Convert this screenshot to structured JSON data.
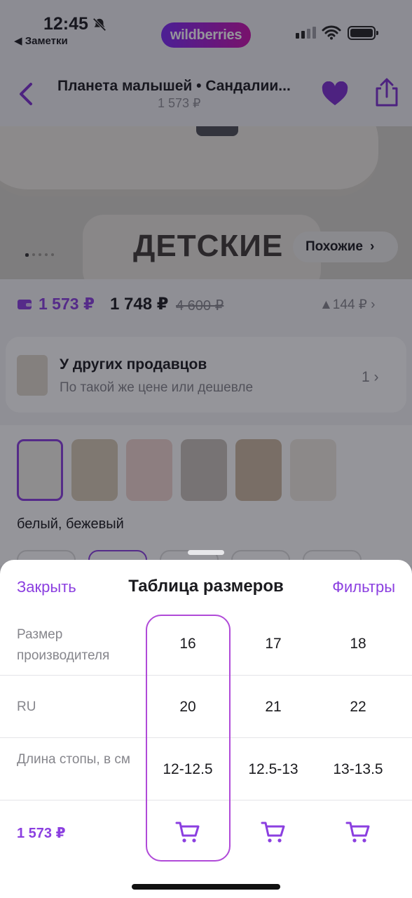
{
  "status_bar": {
    "time": "12:45",
    "back_app": "◀ Заметки",
    "brand": "wildberries"
  },
  "header": {
    "title": "Планета малышей • Сандалии...",
    "price": "1 573 ₽"
  },
  "hero": {
    "banner_text": "ДЕТСКИЕ",
    "similar_label": "Похожие",
    "similar_chevron": "›"
  },
  "price_row": {
    "wallet_price": "1 573 ₽",
    "price": "1 748 ₽",
    "old_price": "4 600 ₽",
    "rating": "▲144 ₽",
    "chevron": "›"
  },
  "sellers": {
    "title": "У других продавцов",
    "subtitle": "По такой же цене или дешевле",
    "count": "1",
    "chevron": "›"
  },
  "colors": {
    "selected_color": "белый, бежевый"
  },
  "sheet": {
    "close_label": "Закрыть",
    "title": "Таблица размеров",
    "filters_label": "Фильтры",
    "rows": [
      {
        "label": "Размер производителя",
        "values": [
          "16",
          "17",
          "18"
        ]
      },
      {
        "label": "RU",
        "values": [
          "20",
          "21",
          "22"
        ]
      },
      {
        "label": "Длина стопы, в см",
        "values": [
          "12-12.5",
          "12.5-13",
          "13-13.5"
        ]
      }
    ],
    "price": "1 573 ₽",
    "selected_column": 0
  },
  "colors_theme": {
    "accent": "#8b3fe0",
    "selection_border": "#b04ad8",
    "muted_text": "#86868c"
  }
}
